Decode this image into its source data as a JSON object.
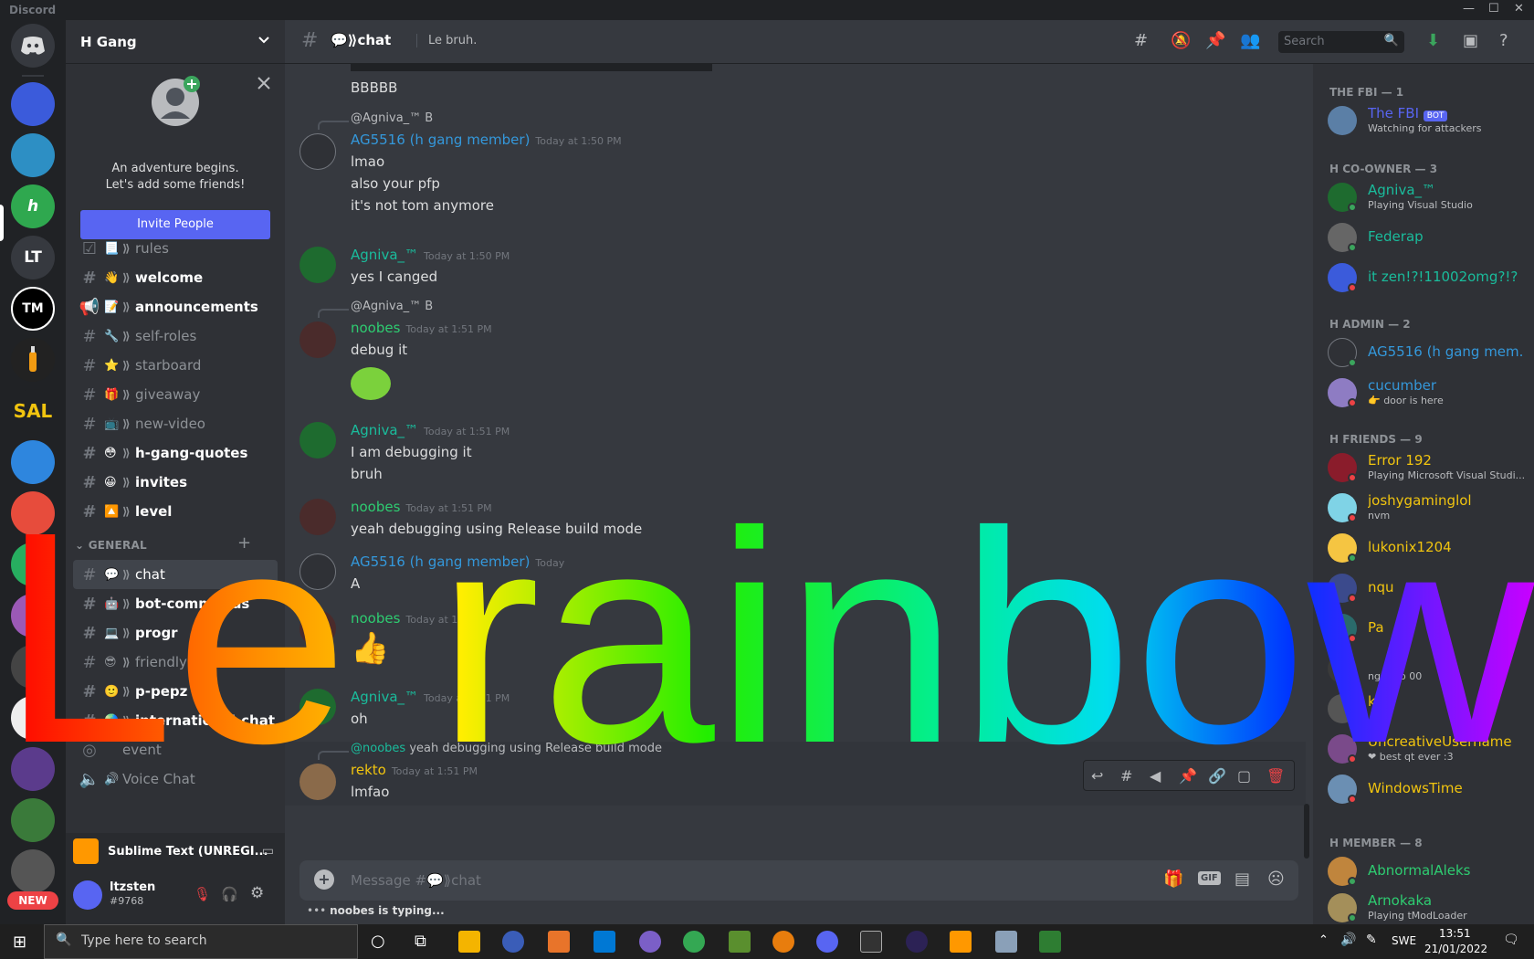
{
  "app": {
    "title": "Discord"
  },
  "server": {
    "name": "H Gang"
  },
  "invite": {
    "line1": "An adventure begins.",
    "line2": "Let's add some friends!",
    "button": "Invite People"
  },
  "channels": [
    {
      "emoji": "📃",
      "name": "rules"
    },
    {
      "emoji": "👋",
      "name": "welcome"
    },
    {
      "emoji": "📝",
      "name": "announcements"
    },
    {
      "emoji": "🔧",
      "name": "self-roles"
    },
    {
      "emoji": "⭐",
      "name": "starboard"
    },
    {
      "emoji": "🎁",
      "name": "giveaway"
    },
    {
      "emoji": "📺",
      "name": "new-video"
    },
    {
      "emoji": "😳",
      "name": "h-gang-quotes"
    },
    {
      "emoji": "😀",
      "name": "invites"
    },
    {
      "emoji": "🔼",
      "name": "level"
    }
  ],
  "general": {
    "category": "GENERAL",
    "channels": [
      {
        "emoji": "💬",
        "name": "chat"
      },
      {
        "emoji": "🤖",
        "name": "bot-commands"
      },
      {
        "emoji": "💻",
        "name": "progr"
      },
      {
        "emoji": "😎",
        "name": "friendly"
      },
      {
        "emoji": "🙂",
        "name": "p-pepz"
      },
      {
        "emoji": "🌏",
        "name": "international-chat"
      },
      {
        "emoji": "",
        "name": "event"
      },
      {
        "emoji": "🔊",
        "name": "Voice Chat"
      }
    ]
  },
  "activity": {
    "name": "Sublime Text (UNREGI..."
  },
  "user": {
    "name": "ltzsten",
    "tag": "#9768"
  },
  "topbar": {
    "channel": "💬⟫chat",
    "topic": "Le bruh.",
    "search": "Search"
  },
  "messages": {
    "m0": {
      "text": "BBBBB"
    },
    "m1": {
      "reply": "@Agniva_™ B",
      "author": "AG5516 (h gang member)",
      "time": "Today at 1:50 PM",
      "lines": [
        "lmao",
        "also your pfp",
        "it's not tom anymore"
      ]
    },
    "m2": {
      "author": "Agniva_™",
      "time": "Today at 1:50 PM",
      "lines": [
        "yes I canged"
      ]
    },
    "m3": {
      "reply": "@Agniva_™ B",
      "author": "noobes",
      "time": "Today at 1:51 PM",
      "lines": [
        "debug it"
      ]
    },
    "m4": {
      "author": "Agniva_™",
      "time": "Today at 1:51 PM",
      "lines": [
        "I am debugging it",
        "bruh"
      ]
    },
    "m5": {
      "author": "noobes",
      "time": "Today at 1:51 PM",
      "lines": [
        "yeah debugging using Release build mode"
      ]
    },
    "m6": {
      "author": "AG5516 (h gang member)",
      "time": "Today",
      "lines": [
        "A"
      ]
    },
    "m7": {
      "author": "noobes",
      "time": "Today at 1:51 PM",
      "emoji": "👍"
    },
    "m8": {
      "author": "Agniva_™",
      "time": "Today at 1:51 PM",
      "lines": [
        "oh"
      ]
    },
    "m9": {
      "reply_user": "@noobes",
      "reply_text": "yeah debugging using Release build mode",
      "author": "rekto",
      "time": "Today at 1:51 PM",
      "lines": [
        "lmfao"
      ]
    }
  },
  "composer": {
    "placeholder": "Message #💬⟫chat"
  },
  "typing": {
    "text": "noobes is typing..."
  },
  "members": {
    "fbi": {
      "title": "THE FBI — 1",
      "members": [
        {
          "name": "The FBI",
          "badge": "BOT",
          "status": "Watching for attackers"
        }
      ]
    },
    "coowner": {
      "title": "H CO-OWNER — 3",
      "members": [
        {
          "name": "Agniva_™",
          "status": "Playing Visual Studio"
        },
        {
          "name": "Federap"
        },
        {
          "name": "it zen!?!11002omg?!?"
        }
      ]
    },
    "admin": {
      "title": "H ADMIN — 2",
      "members": [
        {
          "name": "AG5516 (h gang mem..."
        },
        {
          "name": "cucumber",
          "status": "👉 door is here"
        }
      ]
    },
    "friends": {
      "title": "H FRIENDS — 9",
      "members": [
        {
          "name": "Error 192",
          "status": "Playing Microsoft Visual Studi..."
        },
        {
          "name": "joshygaminglol",
          "status": "nvm"
        },
        {
          "name": "lukonix1204"
        },
        {
          "name": "nqu"
        },
        {
          "name": "Pa"
        },
        {
          "name": "",
          "status": "ng foob 00"
        },
        {
          "name": "kto",
          "status": ""
        },
        {
          "name": "UncreativeUsername",
          "status": "❤ best qt ever :3"
        },
        {
          "name": "WindowsTime"
        }
      ]
    },
    "member": {
      "title": "H MEMBER — 8",
      "members": [
        {
          "name": "AbnormalAleks"
        },
        {
          "name": "Arnokaka",
          "status": "Playing tModLoader"
        }
      ]
    }
  },
  "overlay": {
    "text": "Le rainbow"
  },
  "taskbar": {
    "search": "Type here to search",
    "lang": "SWE",
    "time": "13:51",
    "date": "21/01/2022"
  },
  "guild_labels": {
    "lt": "LT",
    "tm": "TM",
    "sal": "SAL",
    "new": "NEW"
  },
  "colors": {
    "blurple": "#5865f2",
    "agniva": "#1abc9c",
    "blue": "#3498db",
    "noobes": "#2ecc71",
    "rekto": "#f1c40f"
  }
}
